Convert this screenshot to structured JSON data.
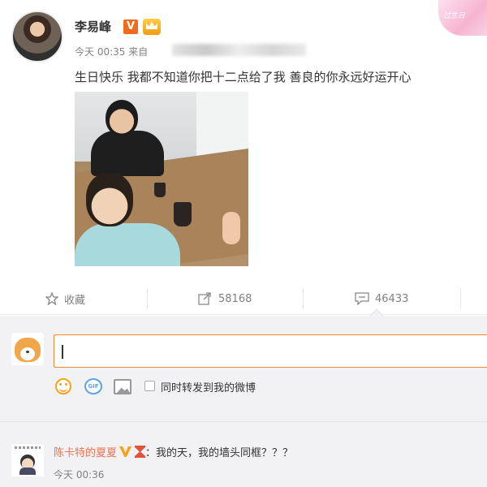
{
  "post": {
    "author": "李易峰",
    "verified_badge": "V",
    "time": "今天 00:35 来自",
    "text": "生日快乐 我都不知道你把十二点给了我 善良的你永远好运开心"
  },
  "sticker": {
    "text": "过生日"
  },
  "actions": {
    "favorite_label": "收藏",
    "forward_count": "58168",
    "comment_count": "46433"
  },
  "composer": {
    "gif_icon_text": "GIF",
    "repost_label": "同时转发到我的微博"
  },
  "comment": {
    "user": "陈卡特的夏夏",
    "text": "：我的天，我的墙头同框？？？",
    "time": "今天 00:36"
  },
  "colors": {
    "accent": "#eb7350",
    "input_border": "#f08a3a",
    "muted": "#808080"
  },
  "icons": [
    "star-icon",
    "forward-icon",
    "comment-icon",
    "emoji-icon",
    "gif-icon",
    "image-icon",
    "vip-icon",
    "crown-icon",
    "hourglass-icon"
  ]
}
